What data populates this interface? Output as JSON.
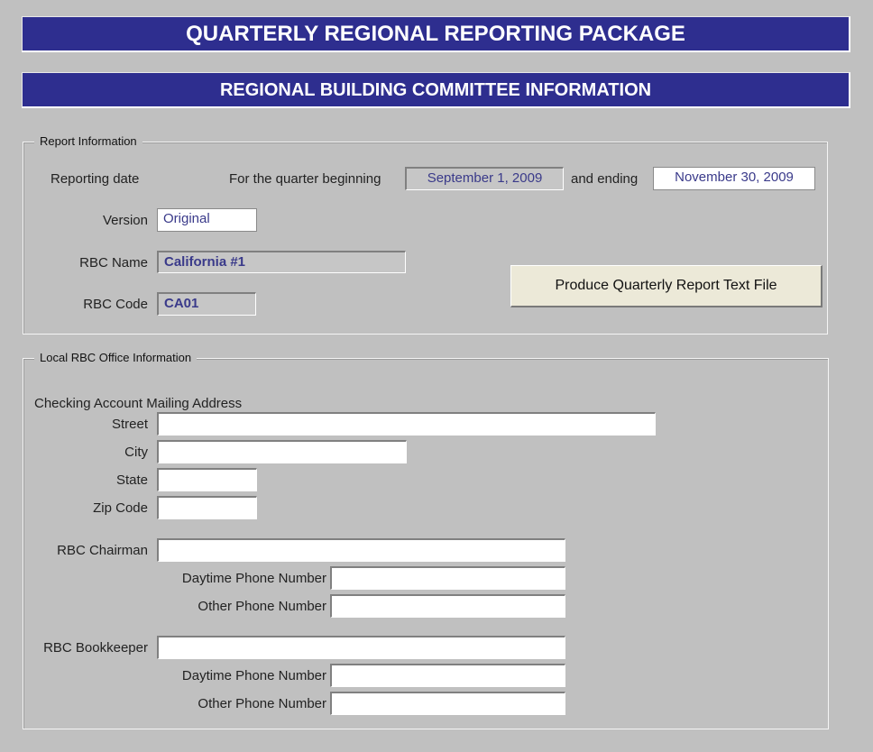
{
  "header": {
    "title": "QUARTERLY REGIONAL REPORTING PACKAGE",
    "subtitle": "REGIONAL BUILDING COMMITTEE INFORMATION"
  },
  "report_info": {
    "legend": "Report Information",
    "reporting_date_label": "Reporting date",
    "quarter_beginning_label": "For the quarter beginning",
    "quarter_beginning_value": "September 1, 2009",
    "and_ending_label": "and ending",
    "quarter_ending_value": "November 30, 2009",
    "version_label": "Version",
    "version_value": "Original",
    "rbc_name_label": "RBC Name",
    "rbc_name_value": "California #1",
    "rbc_code_label": "RBC Code",
    "rbc_code_value": "CA01",
    "produce_button_label": "Produce Quarterly Report Text File"
  },
  "office_info": {
    "legend": "Local RBC Office Information",
    "mailing_address_heading": "Checking Account Mailing Address",
    "street_label": "Street",
    "street_value": "",
    "city_label": "City",
    "city_value": "",
    "state_label": "State",
    "state_value": "",
    "zip_label": "Zip Code",
    "zip_value": "",
    "chairman_label": "RBC Chairman",
    "chairman_value": "",
    "chairman_daytime_label": "Daytime Phone Number",
    "chairman_daytime_value": "",
    "chairman_other_label": "Other Phone Number",
    "chairman_other_value": "",
    "bookkeeper_label": "RBC Bookkeeper",
    "bookkeeper_value": "",
    "bookkeeper_daytime_label": "Daytime Phone Number",
    "bookkeeper_daytime_value": "",
    "bookkeeper_other_label": "Other Phone Number",
    "bookkeeper_other_value": ""
  }
}
